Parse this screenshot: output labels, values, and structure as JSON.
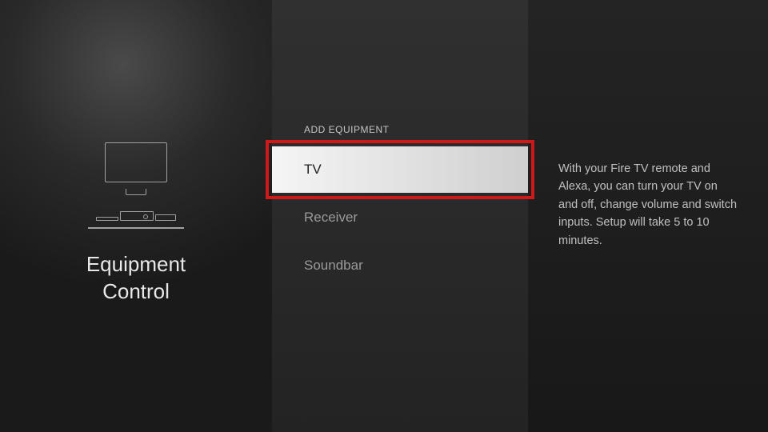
{
  "left": {
    "title_line1": "Equipment",
    "title_line2": "Control"
  },
  "middle": {
    "header": "ADD EQUIPMENT",
    "items": [
      {
        "label": "TV",
        "selected": true
      },
      {
        "label": "Receiver",
        "selected": false
      },
      {
        "label": "Soundbar",
        "selected": false
      }
    ]
  },
  "right": {
    "description": "With your Fire TV remote and Alexa, you can turn your TV on and off, change volume and switch inputs. Setup will take 5 to 10 minutes."
  }
}
